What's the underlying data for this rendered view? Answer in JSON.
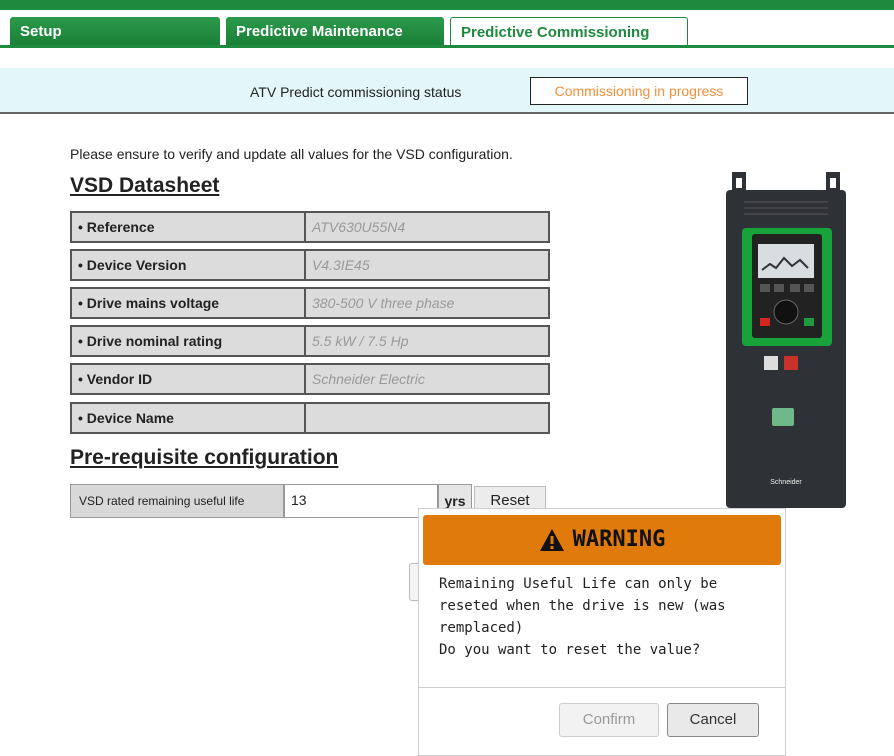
{
  "tabs": [
    {
      "label": "Setup"
    },
    {
      "label": "Predictive Maintenance"
    },
    {
      "label": "Predictive Commissioning"
    }
  ],
  "status": {
    "label": "ATV Predict commissioning status",
    "value": "Commissioning in progress",
    "value_color": "#f0903a"
  },
  "intro": "Please ensure to verify and update all values for the VSD configuration.",
  "datasheet": {
    "title": "VSD Datasheet",
    "rows": [
      {
        "key": "• Reference",
        "value": "ATV630U55N4"
      },
      {
        "key": "• Device Version",
        "value": "V4.3IE45"
      },
      {
        "key": "• Drive mains voltage",
        "value": "380-500 V three phase"
      },
      {
        "key": "• Drive nominal rating",
        "value": "5.5 kW / 7.5 Hp"
      },
      {
        "key": "• Vendor ID",
        "value": "Schneider Electric"
      },
      {
        "key": "• Device Name",
        "value": ""
      }
    ]
  },
  "prereq": {
    "title": "Pre-requisite configuration",
    "rul_label": "VSD rated remaining useful life",
    "rul_value": "13",
    "rul_unit": "yrs",
    "reset_label": "Reset"
  },
  "device_image": {
    "icon": "variable-speed-drive",
    "brand_text": "Schneider"
  },
  "dialog": {
    "title": "WARNING",
    "header_color": "#e07b0b",
    "lines": [
      "Remaining Useful Life can only be",
      "reseted when the drive is new (was",
      "remplaced)",
      "Do you want to reset the value?"
    ],
    "confirm_label": "Confirm",
    "cancel_label": "Cancel"
  },
  "colors": {
    "brand_green": "#1e8a3d"
  }
}
